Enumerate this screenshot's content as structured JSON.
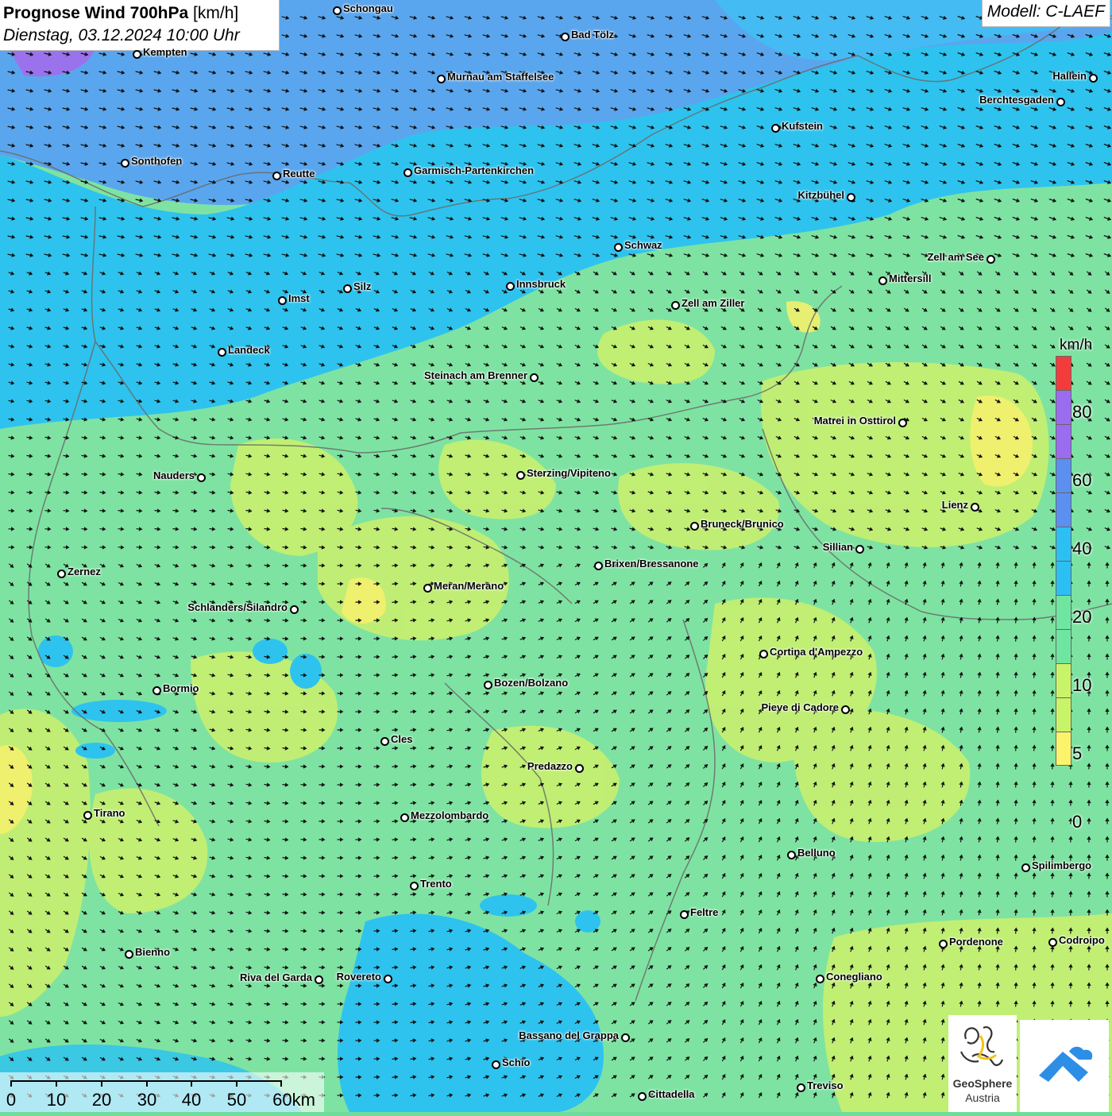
{
  "title": {
    "bold": "Prognose Wind 700hPa",
    "unit": "[km/h]",
    "datetime": "Dienstag, 03.12.2024 10:00 Uhr"
  },
  "model": "Modell: C-LAEF",
  "cities": [
    {
      "name": "Schongau",
      "side": "r"
    },
    {
      "name": "Bad Tölz",
      "side": "r"
    },
    {
      "name": "Kempten",
      "side": "r"
    },
    {
      "name": "Murnau am Staffelsee",
      "side": "r"
    },
    {
      "name": "Hallein",
      "side": "l"
    },
    {
      "name": "Berchtesgaden",
      "side": "l"
    },
    {
      "name": "Kufstein",
      "side": "r"
    },
    {
      "name": "Sonthofen",
      "side": "r"
    },
    {
      "name": "Reutte",
      "side": "r"
    },
    {
      "name": "Garmisch-Partenkirchen",
      "side": "r"
    },
    {
      "name": "Kitzbühel",
      "side": "l"
    },
    {
      "name": "Schwaz",
      "side": "r"
    },
    {
      "name": "Zell am See",
      "side": "l"
    },
    {
      "name": "Mittersill",
      "side": "r"
    },
    {
      "name": "Innsbruck",
      "side": "r"
    },
    {
      "name": "Silz",
      "side": "r"
    },
    {
      "name": "Imst",
      "side": "r"
    },
    {
      "name": "Zell am Ziller",
      "side": "r"
    },
    {
      "name": "Landeck",
      "side": "r"
    },
    {
      "name": "Steinach am Brenner",
      "side": "l"
    },
    {
      "name": "Matrei in Osttirol",
      "side": "l"
    },
    {
      "name": "Nauders",
      "side": "l"
    },
    {
      "name": "Sterzing/Vipiteno",
      "side": "r"
    },
    {
      "name": "Lienz",
      "side": "l"
    },
    {
      "name": "Bruneck/Brunico",
      "side": "r"
    },
    {
      "name": "Sillian",
      "side": "l"
    },
    {
      "name": "Brixen/Bressanone",
      "side": "r"
    },
    {
      "name": "Zernez",
      "side": "r"
    },
    {
      "name": "Meran/Merano",
      "side": "r"
    },
    {
      "name": "Schlanders/Silandro",
      "side": "l"
    },
    {
      "name": "Cortina d'Ampezzo",
      "side": "r"
    },
    {
      "name": "Bozen/Bolzano",
      "side": "r"
    },
    {
      "name": "Bormio",
      "side": "r"
    },
    {
      "name": "Pieve di Cadore",
      "side": "l"
    },
    {
      "name": "Cles",
      "side": "r"
    },
    {
      "name": "Predazzo",
      "side": "l"
    },
    {
      "name": "Tirano",
      "side": "r"
    },
    {
      "name": "Mezzolombardo",
      "side": "r"
    },
    {
      "name": "Belluno",
      "side": "r"
    },
    {
      "name": "Spilimbergo",
      "side": "r"
    },
    {
      "name": "Trento",
      "side": "r"
    },
    {
      "name": "Feltre",
      "side": "r"
    },
    {
      "name": "Pordenone",
      "side": "r"
    },
    {
      "name": "Codroipo",
      "side": "r"
    },
    {
      "name": "Bienno",
      "side": "r"
    },
    {
      "name": "Riva del Garda",
      "side": "l"
    },
    {
      "name": "Rovereto",
      "side": "l"
    },
    {
      "name": "Conegliano",
      "side": "r"
    },
    {
      "name": "Bassano del Grappa",
      "side": "l"
    },
    {
      "name": "Schio",
      "side": "r"
    },
    {
      "name": "Treviso",
      "side": "r"
    },
    {
      "name": "Cittadella",
      "side": "r"
    }
  ],
  "legend": {
    "unit": "km/h",
    "classes": [
      {
        "label": "80",
        "color": "#f23c3c"
      },
      {
        "label": "",
        "color": "#9b6cf0"
      },
      {
        "label": "60",
        "color": "#9b6cf0"
      },
      {
        "label": "",
        "color": "#5b8ff0"
      },
      {
        "label": "40",
        "color": "#5b8ff0"
      },
      {
        "label": "",
        "color": "#2cc0f2"
      },
      {
        "label": "20",
        "color": "#2cc0f2"
      },
      {
        "label": "",
        "color": "#6fe6a0"
      },
      {
        "label": "10",
        "color": "#6fe6a0"
      },
      {
        "label": "",
        "color": "#c8f46a"
      },
      {
        "label": "5",
        "color": "#c8f46a"
      },
      {
        "label": "0",
        "color": "#fbf46a"
      }
    ],
    "ticks": [
      "80",
      "60",
      "40",
      "20",
      "10",
      "5",
      "0"
    ]
  },
  "scale_bar": {
    "labels": [
      "0",
      "10",
      "20",
      "30",
      "40",
      "50",
      "60km"
    ]
  },
  "logos": {
    "geosphere_line1": "GeoSphere",
    "geosphere_line2": "Austria"
  },
  "colors": {
    "calm": "#fbf46a",
    "light": "#c8f46a",
    "moderate": "#6fe6a0",
    "fresh": "#2cc0f2",
    "strong": "#5b8ff0",
    "storm": "#9b6cf0"
  }
}
